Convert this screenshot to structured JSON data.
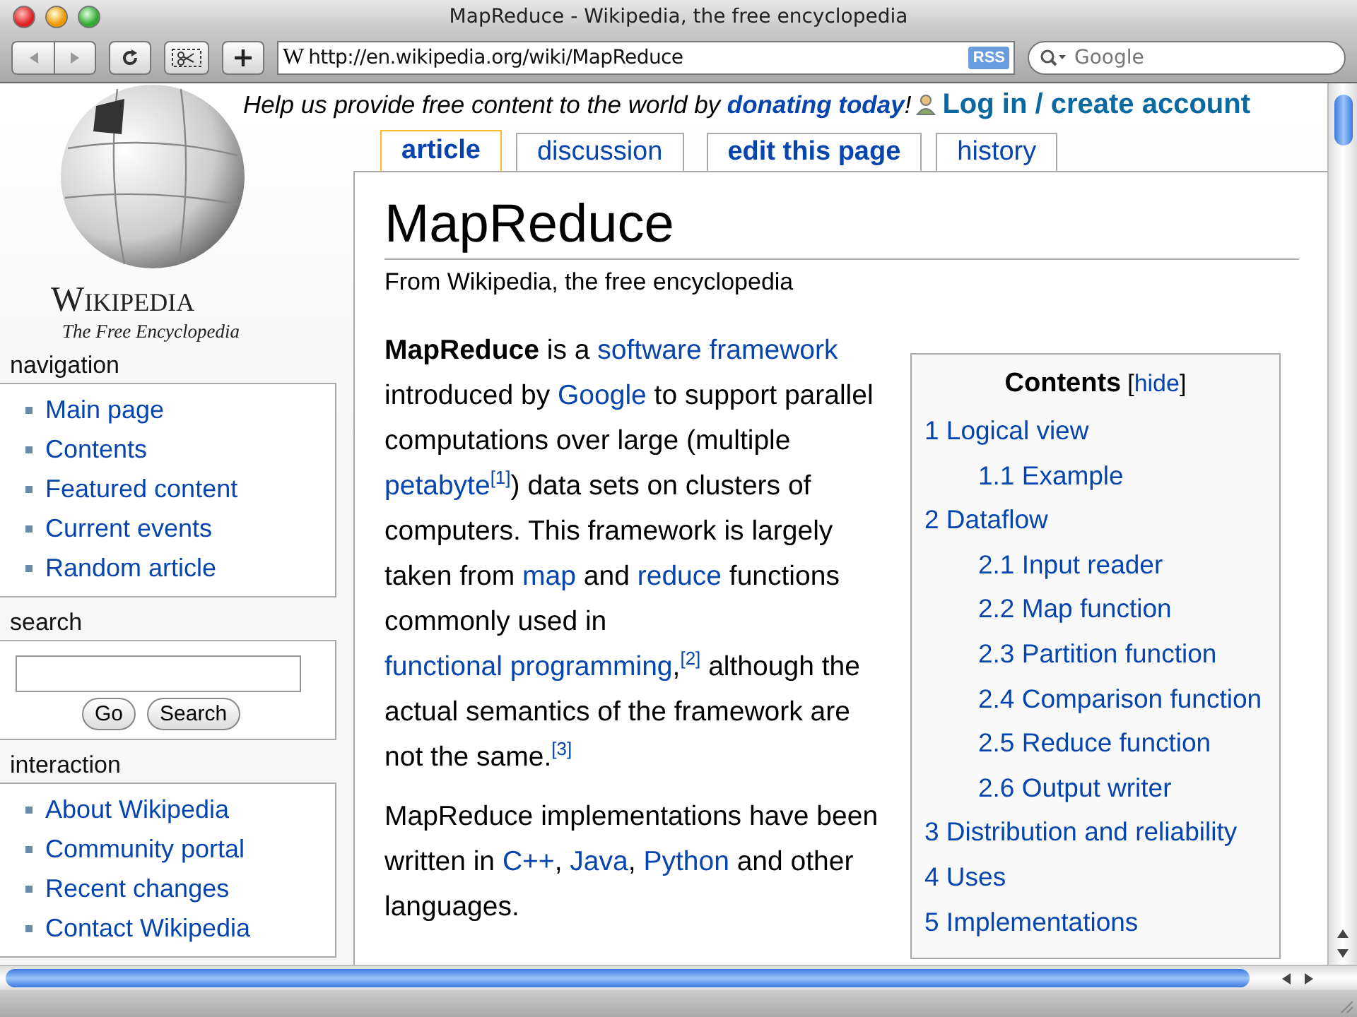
{
  "window": {
    "title": "MapReduce - Wikipedia, the free encyclopedia"
  },
  "toolbar": {
    "site_icon": "W",
    "url": "http://en.wikipedia.org/wiki/MapReduce",
    "rss": "RSS",
    "search_placeholder": "Google"
  },
  "banner": {
    "parts": [
      {
        "kind": "plain",
        "text": "Help us provide free content to the world by "
      },
      {
        "kind": "link",
        "text": "donating today"
      },
      {
        "kind": "plain",
        "text": "!"
      }
    ],
    "login": "Log in / create account"
  },
  "logo": {
    "name": "Wikipedia",
    "tagline": "The Free Encyclopedia"
  },
  "tabs": [
    {
      "label": "article",
      "kind": "page",
      "selected": true
    },
    {
      "label": "discussion",
      "kind": "page",
      "selected": false
    },
    {
      "label": "edit this page",
      "kind": "action",
      "selected": false
    },
    {
      "label": "history",
      "kind": "page",
      "selected": false
    }
  ],
  "sidebar": {
    "navigation": {
      "heading": "navigation",
      "items": [
        "Main page",
        "Contents",
        "Featured content",
        "Current events",
        "Random article"
      ]
    },
    "search": {
      "heading": "search",
      "buttons": [
        "Go",
        "Search"
      ]
    },
    "interaction": {
      "heading": "interaction",
      "items": [
        "About Wikipedia",
        "Community portal",
        "Recent changes",
        "Contact Wikipedia"
      ]
    }
  },
  "article": {
    "title": "MapReduce",
    "subtitle": "From Wikipedia, the free encyclopedia",
    "paragraphs": [
      [
        {
          "kind": "bold",
          "text": "MapReduce"
        },
        {
          "kind": "plain",
          "text": " is a "
        },
        {
          "kind": "link",
          "text": "software framework"
        },
        {
          "kind": "plain",
          "text": " introduced by "
        },
        {
          "kind": "link",
          "text": "Google"
        },
        {
          "kind": "plain",
          "text": " to support parallel computations over large (multiple "
        },
        {
          "kind": "link",
          "text": "petabyte"
        },
        {
          "kind": "ref",
          "text": "[1]"
        },
        {
          "kind": "plain",
          "text": ") data sets on clusters of computers. This framework is largely taken from "
        },
        {
          "kind": "link",
          "text": "map"
        },
        {
          "kind": "plain",
          "text": " and "
        },
        {
          "kind": "link",
          "text": "reduce"
        },
        {
          "kind": "plain",
          "text": " functions commonly used in "
        },
        {
          "kind": "link",
          "text": "functional programming"
        },
        {
          "kind": "plain",
          "text": ","
        },
        {
          "kind": "ref",
          "text": "[2]"
        },
        {
          "kind": "plain",
          "text": " although the actual semantics of the framework are not the same."
        },
        {
          "kind": "ref",
          "text": "[3]"
        }
      ],
      [
        {
          "kind": "plain",
          "text": "MapReduce implementations have been written in "
        },
        {
          "kind": "link",
          "text": "C++"
        },
        {
          "kind": "plain",
          "text": ", "
        },
        {
          "kind": "link",
          "text": "Java"
        },
        {
          "kind": "plain",
          "text": ", "
        },
        {
          "kind": "link",
          "text": "Python"
        },
        {
          "kind": "plain",
          "text": " and other languages."
        }
      ]
    ],
    "toc": {
      "title": "Contents",
      "toggle_open": "[",
      "toggle": "hide",
      "toggle_close": "]",
      "items": [
        {
          "label": "1 Logical view",
          "children": [
            {
              "label": "1.1 Example"
            }
          ]
        },
        {
          "label": "2 Dataflow",
          "children": [
            {
              "label": "2.1 Input reader"
            },
            {
              "label": "2.2 Map function"
            },
            {
              "label": "2.3 Partition function"
            },
            {
              "label": "2.4 Comparison function"
            },
            {
              "label": "2.5 Reduce function"
            },
            {
              "label": "2.6 Output writer"
            }
          ]
        },
        {
          "label": "3 Distribution and reliability"
        },
        {
          "label": "4 Uses"
        },
        {
          "label": "5 Implementations"
        }
      ]
    }
  }
}
